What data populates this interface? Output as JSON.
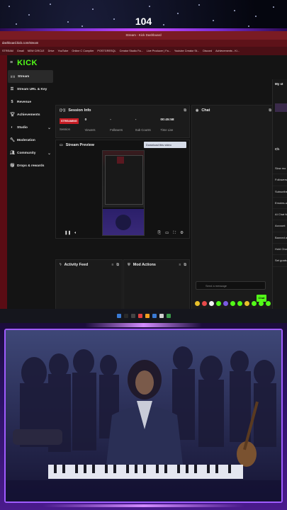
{
  "overlay": {
    "counter": "104"
  },
  "browser": {
    "window_title": "Stream - Kick Dashboard",
    "url": "dashboard.kick.com/stream",
    "bookmarks": [
      "STREAM",
      "Gmail",
      "NEW CIRCLE",
      "Drive",
      "YouTube",
      "Online C Compiler",
      "POSTGRESQL",
      "Creator Studio Fa...",
      "Live Producer | Fa...",
      "Youtube Creator St...",
      "Discord",
      "Achievements - Ki..."
    ]
  },
  "app": {
    "logo": "KICK",
    "sidebar": [
      {
        "label": "Stream",
        "icon": "broadcast-icon",
        "active": true,
        "chevron": false
      },
      {
        "label": "Stream URL & Key",
        "icon": "key-icon",
        "active": false,
        "chevron": false
      },
      {
        "label": "Revenue",
        "icon": "dollar-icon",
        "active": false,
        "chevron": false
      },
      {
        "label": "Achievements",
        "icon": "trophy-icon",
        "active": false,
        "chevron": false
      },
      {
        "label": "Studio",
        "icon": "palette-icon",
        "active": false,
        "chevron": true
      },
      {
        "label": "Moderation",
        "icon": "wrench-icon",
        "active": false,
        "chevron": false
      },
      {
        "label": "Community",
        "icon": "people-icon",
        "active": false,
        "chevron": true
      },
      {
        "label": "Drops & rewards",
        "icon": "gift-icon",
        "active": false,
        "chevron": false
      }
    ],
    "session_info": {
      "title": "Session Info",
      "badge": "STREAMING",
      "stats": [
        {
          "value": "",
          "label": "Session"
        },
        {
          "value": "0",
          "label": "Viewers"
        },
        {
          "value": "-",
          "label": "Followers"
        },
        {
          "value": "-",
          "label": "Sub Counts"
        },
        {
          "value": "00:45:58",
          "label": "Time Live"
        }
      ]
    },
    "stream_preview": {
      "title": "Stream Preview",
      "download_button": "Download this video"
    },
    "activity_feed": {
      "title": "Activity Feed"
    },
    "mod_actions": {
      "title": "Mod Actions"
    },
    "chat": {
      "title": "Chat",
      "placeholder": "Send a message",
      "send_label": "Chat",
      "right_title_1": "My st",
      "right_title_2": "Ch",
      "settings_items": [
        "Slow mo",
        "Followers",
        "Subscribe",
        "Emotes-o",
        "AI Chat M",
        "Account",
        "Banned w",
        "Hold Cha",
        "Set goals"
      ]
    }
  },
  "colors": {
    "kick_green": "#53fc18",
    "streaming_red": "#c81d25",
    "browser_red": "#7a1b23",
    "frame_purple": "#a05cff"
  }
}
